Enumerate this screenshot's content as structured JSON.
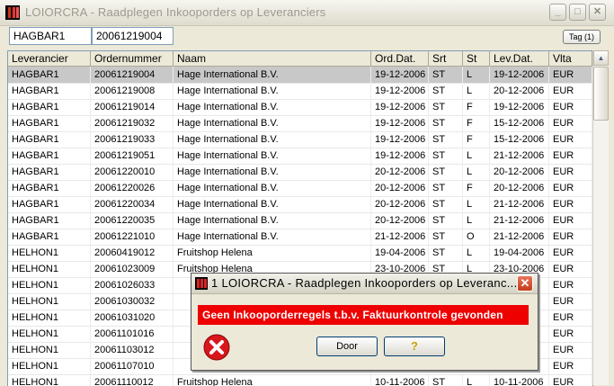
{
  "window": {
    "title": "LOIORCRA - Raadplegen Inkooporders op Leveranciers",
    "minimize_glyph": "_",
    "maximize_glyph": "□",
    "close_glyph": "✕"
  },
  "search": {
    "leverancier_value": "HAGBAR1",
    "order_value": "20061219004",
    "tag_label": "Tag (1)"
  },
  "grid": {
    "columns": [
      "Leverancier",
      "Ordernummer",
      "Naam",
      "Ord.Dat.",
      "Srt",
      "St",
      "Lev.Dat.",
      "Vlta"
    ],
    "rows": [
      [
        "HAGBAR1",
        "20061219004",
        "Hage International B.V.",
        "19-12-2006",
        "ST",
        "L",
        "19-12-2006",
        "EUR"
      ],
      [
        "HAGBAR1",
        "20061219008",
        "Hage International B.V.",
        "19-12-2006",
        "ST",
        "L",
        "20-12-2006",
        "EUR"
      ],
      [
        "HAGBAR1",
        "20061219014",
        "Hage International B.V.",
        "19-12-2006",
        "ST",
        "F",
        "19-12-2006",
        "EUR"
      ],
      [
        "HAGBAR1",
        "20061219032",
        "Hage International B.V.",
        "19-12-2006",
        "ST",
        "F",
        "15-12-2006",
        "EUR"
      ],
      [
        "HAGBAR1",
        "20061219033",
        "Hage International B.V.",
        "19-12-2006",
        "ST",
        "F",
        "15-12-2006",
        "EUR"
      ],
      [
        "HAGBAR1",
        "20061219051",
        "Hage International B.V.",
        "19-12-2006",
        "ST",
        "L",
        "21-12-2006",
        "EUR"
      ],
      [
        "HAGBAR1",
        "20061220010",
        "Hage International B.V.",
        "20-12-2006",
        "ST",
        "L",
        "20-12-2006",
        "EUR"
      ],
      [
        "HAGBAR1",
        "20061220026",
        "Hage International B.V.",
        "20-12-2006",
        "ST",
        "F",
        "20-12-2006",
        "EUR"
      ],
      [
        "HAGBAR1",
        "20061220034",
        "Hage International B.V.",
        "20-12-2006",
        "ST",
        "L",
        "21-12-2006",
        "EUR"
      ],
      [
        "HAGBAR1",
        "20061220035",
        "Hage International B.V.",
        "20-12-2006",
        "ST",
        "L",
        "21-12-2006",
        "EUR"
      ],
      [
        "HAGBAR1",
        "20061221010",
        "Hage International B.V.",
        "21-12-2006",
        "ST",
        "O",
        "21-12-2006",
        "EUR"
      ],
      [
        "HELHON1",
        "20060419012",
        "Fruitshop Helena",
        "19-04-2006",
        "ST",
        "L",
        "19-04-2006",
        "EUR"
      ],
      [
        "HELHON1",
        "20061023009",
        "Fruitshop Helena",
        "23-10-2006",
        "ST",
        "L",
        "23-10-2006",
        "EUR"
      ],
      [
        "HELHON1",
        "20061026033",
        "",
        "",
        "",
        "",
        "",
        "EUR"
      ],
      [
        "HELHON1",
        "20061030032",
        "",
        "",
        "",
        "",
        "",
        "EUR"
      ],
      [
        "HELHON1",
        "20061031020",
        "",
        "",
        "",
        "",
        "",
        "EUR"
      ],
      [
        "HELHON1",
        "20061101016",
        "",
        "",
        "",
        "",
        "",
        "EUR"
      ],
      [
        "HELHON1",
        "20061103012",
        "",
        "",
        "",
        "",
        "",
        "EUR"
      ],
      [
        "HELHON1",
        "20061107010",
        "",
        "",
        "",
        "",
        "",
        "EUR"
      ],
      [
        "HELHON1",
        "20061110012",
        "Fruitshop Helena",
        "10-11-2006",
        "ST",
        "L",
        "10-11-2006",
        "EUR"
      ]
    ],
    "selected_row": 0
  },
  "dialog": {
    "title": "1 LOIORCRA - Raadplegen Inkooporders op Leveranc...",
    "message": "Geen Inkooporderregels t.b.v. Faktuurkontrole gevonden",
    "door_label": "Door",
    "help_glyph": "?",
    "close_glyph": "✕"
  },
  "colors": {
    "error_red": "#ee0000",
    "selected_row": "#c8c8c8"
  }
}
